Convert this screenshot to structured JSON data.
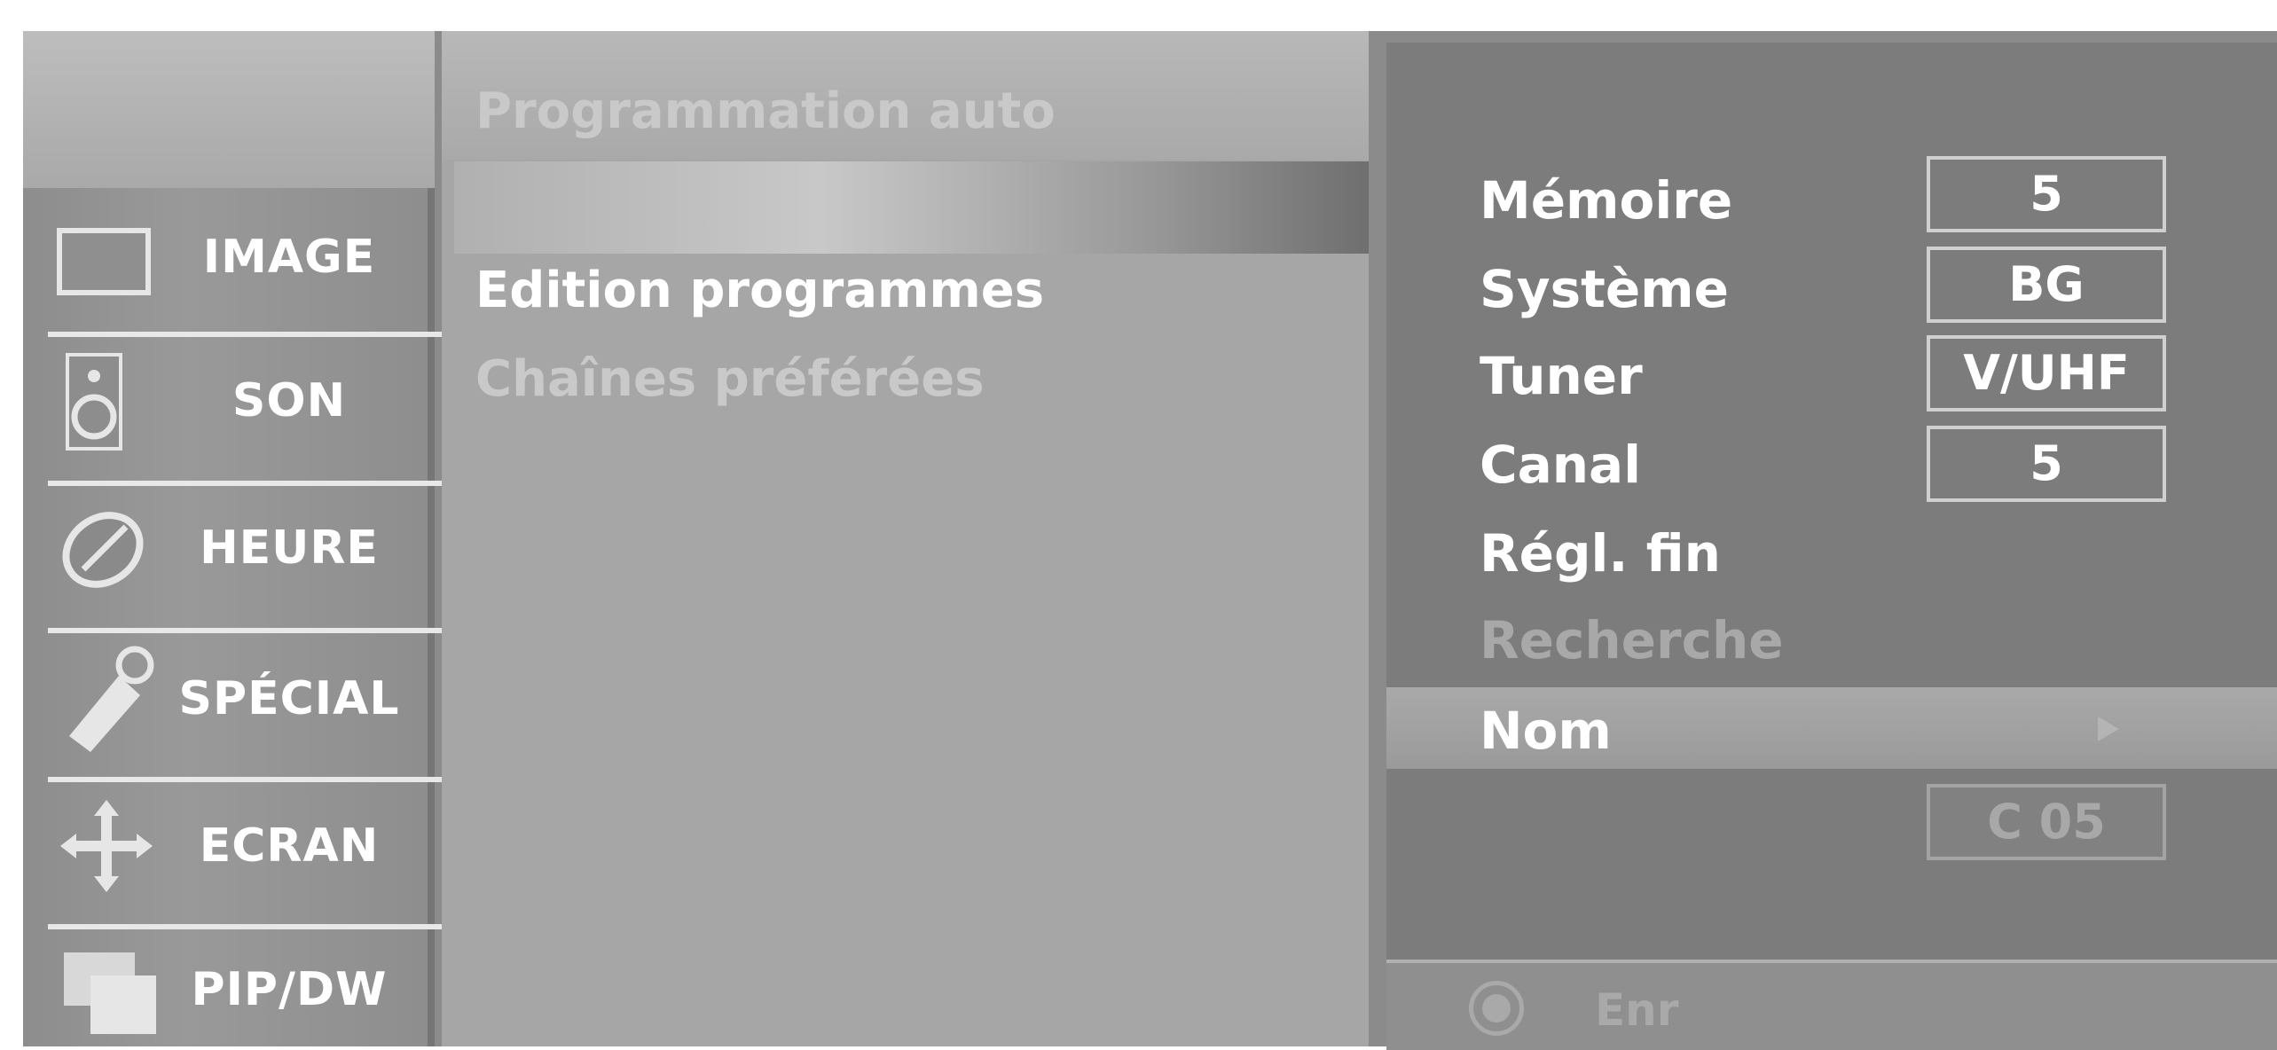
{
  "sidebar": {
    "items": [
      {
        "label": "IMAGE",
        "icon": "image-icon"
      },
      {
        "label": "SON",
        "icon": "speaker-icon"
      },
      {
        "label": "HEURE",
        "icon": "clock-icon"
      },
      {
        "label": "SPÉCIAL",
        "icon": "tag-icon"
      },
      {
        "label": "ECRAN",
        "icon": "move-arrows-icon"
      },
      {
        "label": "PIP/DW",
        "icon": "pip-icon"
      }
    ]
  },
  "main_menu": {
    "items": [
      {
        "label": "Programmation auto"
      },
      {
        "label": "Edition programmes"
      },
      {
        "label": "Chaînes préférées"
      }
    ]
  },
  "settings": {
    "memoire": {
      "label": "Mémoire",
      "value": "5"
    },
    "systeme": {
      "label": "Système",
      "value": "BG"
    },
    "tuner": {
      "label": "Tuner",
      "value": "V/UHF"
    },
    "canal": {
      "label": "Canal",
      "value": "5"
    },
    "regl_fin": {
      "label": "Régl. fin"
    },
    "recherche": {
      "label": "Recherche"
    },
    "nom": {
      "label": "Nom",
      "value": "C 05"
    }
  },
  "footer": {
    "enr_label": "Enr"
  },
  "colors": {
    "screen_bg": "#8b8b8b",
    "panel_bg": "#7c7c7c",
    "highlight": "#a9a9a9",
    "text_active": "#ffffff",
    "text_dim": "#a8a8a8"
  }
}
